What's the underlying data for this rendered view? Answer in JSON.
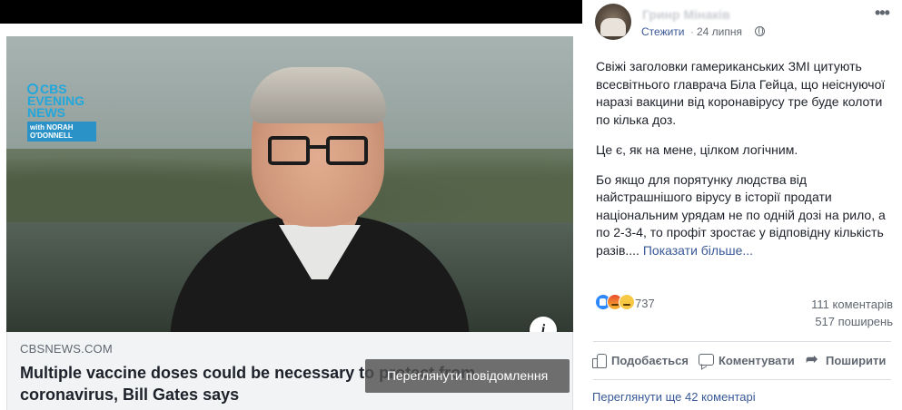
{
  "media": {
    "logo_line1": "CBS",
    "logo_line2": "EVENING",
    "logo_line3": "NEWS",
    "logo_box": "with NORAH O'DONNELL",
    "info_label": "i"
  },
  "link_preview": {
    "domain": "CBSNEWS.COM",
    "title": "Multiple vaccine doses could be necessary to protect from coronavirus, Bill Gates says",
    "view_post_label": "Переглянути повідомлення"
  },
  "post": {
    "author": "Гринр Мінаків",
    "follow_label": "Стежити",
    "separator": "·",
    "time": "24 липня",
    "more_label": "•••",
    "paragraphs": [
      "Свіжі заголовки гамериканських ЗМІ цитують всесвітнього главрача Біла Гейца, що неіснуючої наразі вакцини від коронавірусу тре буде колоти по кілька доз.",
      "Це є, як на мене, цілком логічним.",
      "Бо якщо для порятунку людства від найстрашнішого вірусу в історії продати національним урядам не по одній дозі на рило, а по 2-3-4, то профіт зростає у відповідну кількість разів...."
    ],
    "see_more": " Показати більше...",
    "reactions_count": "737",
    "reaction_types": [
      "like",
      "angry",
      "sad"
    ],
    "comments_count": "111 коментарів",
    "shares_count": "517 поширень",
    "actions": {
      "like": "Подобається",
      "comment": "Коментувати",
      "share": "Поширити"
    },
    "view_more_comments": "Переглянути ще 42 коментарі"
  },
  "colors": {
    "link_blue": "#385898",
    "meta_gray": "#606770",
    "cbs_blue": "#22a7dc",
    "like_blue": "#2d88ff"
  }
}
